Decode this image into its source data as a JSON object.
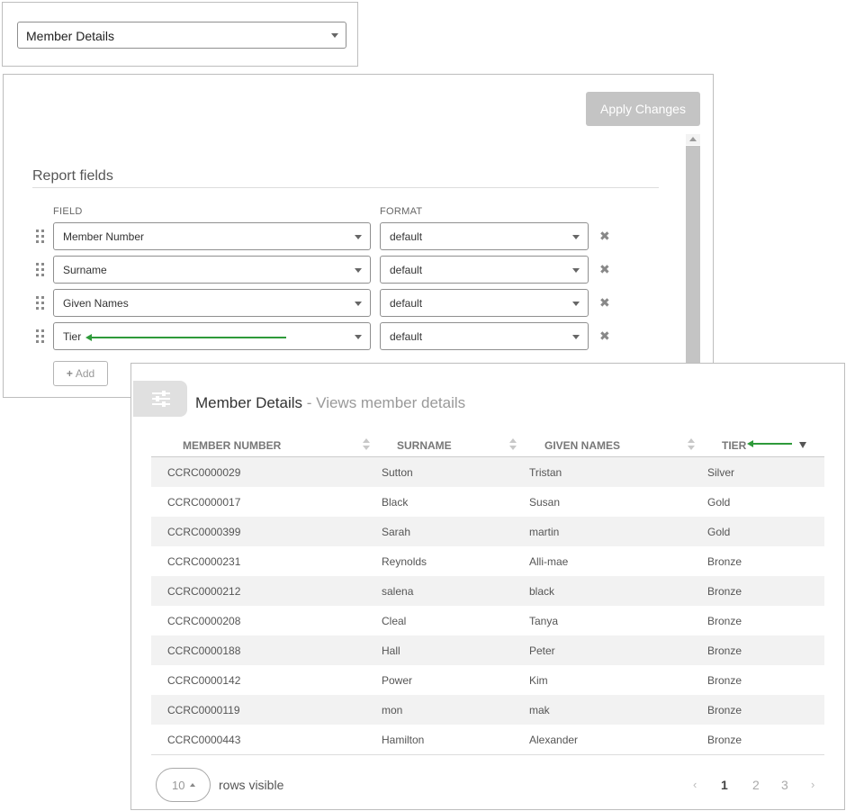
{
  "report_selector": {
    "value": "Member Details"
  },
  "fields_panel": {
    "apply_label": "Apply Changes",
    "section_title": "Report fields",
    "field_column_label": "FIELD",
    "format_column_label": "FORMAT",
    "rows": [
      {
        "field": "Member Number",
        "format": "default"
      },
      {
        "field": "Surname",
        "format": "default"
      },
      {
        "field": "Given Names",
        "format": "default"
      },
      {
        "field": "Tier",
        "format": "default"
      }
    ],
    "remove_glyph": "✖",
    "add_glyph": "+",
    "add_label": "Add"
  },
  "results": {
    "report_name": "Member Details",
    "separator": " - ",
    "report_description": "Views member details",
    "columns": [
      "MEMBER NUMBER",
      "SURNAME",
      "GIVEN NAMES",
      "TIER"
    ],
    "rows": [
      [
        "CCRC0000029",
        "Sutton",
        "Tristan",
        "Silver"
      ],
      [
        "CCRC0000017",
        "Black",
        "Susan",
        "Gold"
      ],
      [
        "CCRC0000399",
        "Sarah",
        "martin",
        "Gold"
      ],
      [
        "CCRC0000231",
        "Reynolds",
        "Alli-mae",
        "Bronze"
      ],
      [
        "CCRC0000212",
        "salena",
        "black",
        "Bronze"
      ],
      [
        "CCRC0000208",
        "Cleal",
        "Tanya",
        "Bronze"
      ],
      [
        "CCRC0000188",
        "Hall",
        "Peter",
        "Bronze"
      ],
      [
        "CCRC0000142",
        "Power",
        "Kim",
        "Bronze"
      ],
      [
        "CCRC0000119",
        "mon",
        "mak",
        "Bronze"
      ],
      [
        "CCRC0000443",
        "Hamilton",
        "Alexander",
        "Bronze"
      ]
    ],
    "rows_visible_value": "10",
    "rows_visible_label": "rows visible",
    "pager": {
      "prev": "‹",
      "pages": [
        "1",
        "2",
        "3"
      ],
      "current": "1",
      "next": "›"
    }
  },
  "colors": {
    "annotation_arrow": "#2e9a3a",
    "button_disabled": "#c4c4c4",
    "stripe": "#f2f2f2"
  },
  "icons": [
    "chevron-down-icon",
    "drag-handle-icon",
    "remove-icon",
    "plus-icon",
    "sliders-icon",
    "sort-icon",
    "sort-desc-icon",
    "annotation-arrow-icon"
  ]
}
